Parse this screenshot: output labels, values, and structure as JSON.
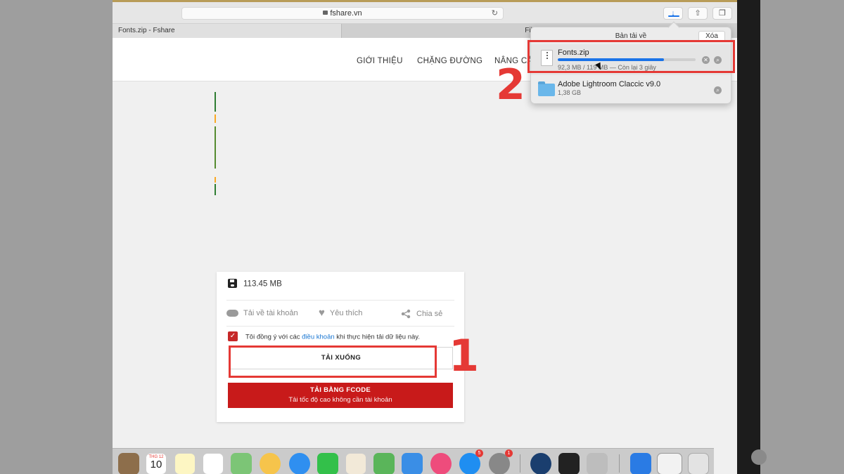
{
  "browser": {
    "address": "fshare.vn",
    "tabs": [
      {
        "label": "Fonts.zip - Fshare"
      },
      {
        "label": "File Manag"
      }
    ]
  },
  "site": {
    "nav": [
      "GIỚI THIỆU",
      "CHẶNG ĐƯỜNG",
      "NÂNG CẤ"
    ]
  },
  "card": {
    "file_size": "113.45 MB",
    "actions": [
      "Tải về tài khoản",
      "Yêu thích",
      "Chia sẻ"
    ],
    "agree_prefix": "Tôi đồng ý với các ",
    "agree_link": "điều khoản",
    "agree_suffix": " khi thực hiện tải dữ liệu này.",
    "download_label": "TẢI XUỐNG",
    "fcode_title": "TẢI BẰNG FCODE",
    "fcode_subtitle": "Tải tốc độ cao không cần tài khoản"
  },
  "downloads_popover": {
    "title": "Bản tải về",
    "clear_label": "Xóa",
    "items": [
      {
        "name": "Fonts.zip",
        "status": "92,3 MB / 119 MB — Còn lại 3 giây",
        "progress": 0.77
      },
      {
        "name": "Adobe Lightroom Claccic v9.0",
        "status": "1,38 GB"
      }
    ]
  },
  "annotations": {
    "step1": "1",
    "step2": "2"
  },
  "dock": {
    "calendar_month": "THG 12",
    "calendar_day": "10",
    "badges": {
      "appstore": "5",
      "settings": "1"
    }
  },
  "colors": {
    "accent_red": "#c81a1a",
    "annotation_red": "#e53935",
    "link_blue": "#1976d2",
    "progress_blue": "#1a73e8"
  },
  "icons": [
    "lock-icon",
    "reload-icon",
    "download-icon",
    "share-icon",
    "tabs-icon",
    "floppy-icon",
    "cloud-download-icon",
    "heart-icon",
    "share-nodes-icon",
    "checkbox-icon",
    "zip-file-icon",
    "folder-icon",
    "cancel-icon",
    "magnifier-icon"
  ]
}
